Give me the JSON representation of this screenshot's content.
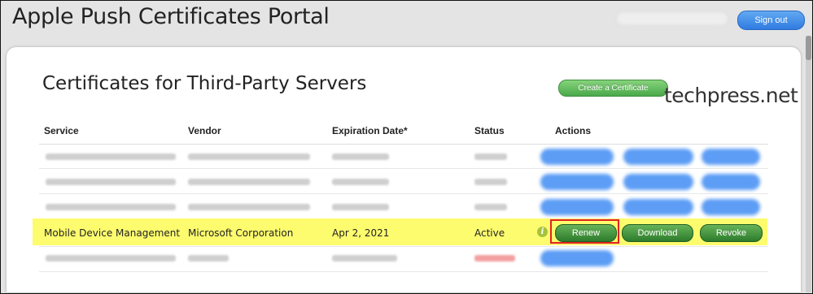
{
  "header": {
    "title": "Apple Push Certificates Portal",
    "sign_out_label": "Sign out"
  },
  "main": {
    "section_title": "Certificates for Third-Party Servers",
    "create_button_label": "Create a Certificate",
    "watermark": "techpress.net",
    "columns": [
      "Service",
      "Vendor",
      "Expiration Date*",
      "Status",
      "Actions"
    ]
  },
  "highlighted_row": {
    "service": "Mobile Device Management",
    "vendor": "Microsoft Corporation",
    "expiration": "Apr 2, 2021",
    "status": "Active",
    "info_icon": "i",
    "actions": [
      "Renew",
      "Download",
      "Revoke"
    ]
  },
  "colors": {
    "highlight": "#fdfc6e",
    "action_green": "#2d7c2c",
    "sign_out_blue": "#2f7be0",
    "renew_outline": "#e12222"
  }
}
